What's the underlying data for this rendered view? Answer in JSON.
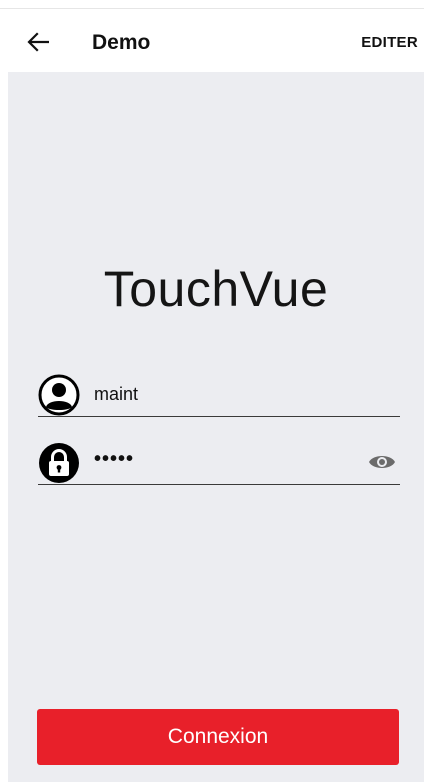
{
  "app_bar": {
    "back_icon": "arrow-left-icon",
    "title": "Demo",
    "edit_label": "EDITER"
  },
  "login": {
    "brand": "TouchVue",
    "username": {
      "icon": "user-circle-icon",
      "value": "maint"
    },
    "password": {
      "icon": "lock-icon",
      "masked_value": "•••••",
      "visibility_icon": "eye-icon"
    },
    "submit_label": "Connexion"
  },
  "colors": {
    "accent": "#e8202a",
    "background": "#ecedf1",
    "app_bar": "#ffffff"
  }
}
